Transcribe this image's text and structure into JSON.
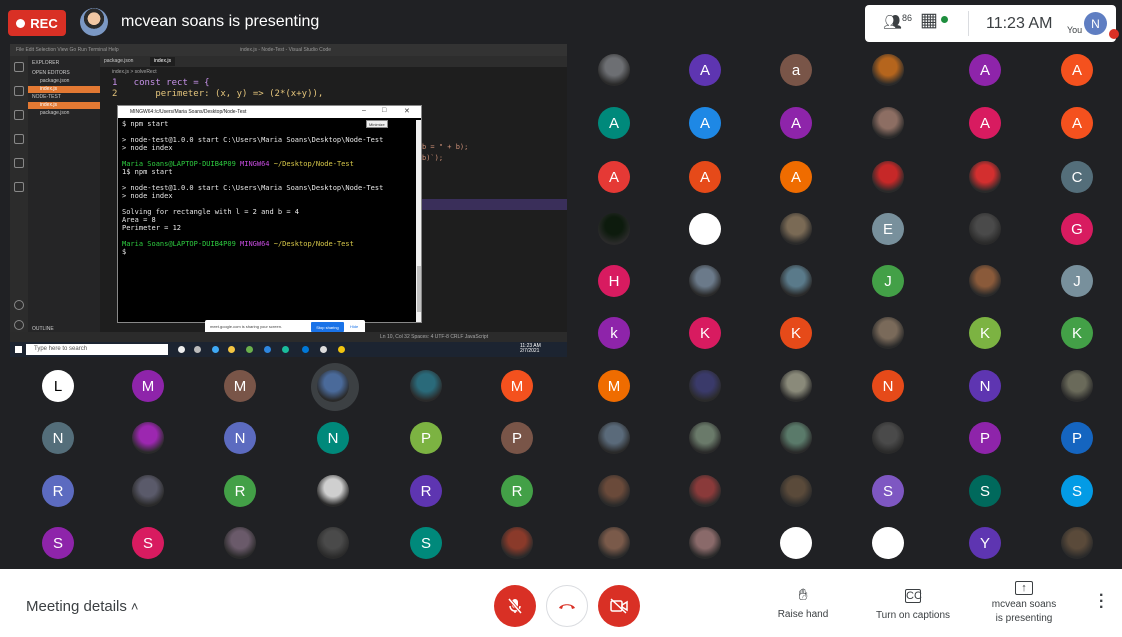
{
  "topbar": {
    "rec_label": "REC",
    "presenter_title": "mcvean soans is presenting",
    "participant_count": "86",
    "time": "11:23 AM",
    "you_label": "You",
    "self_initial": "N"
  },
  "screen": {
    "vscode_title": "index.js - Node-Test - Visual Studio Code",
    "menu": "File  Edit  Selection  View  Go  Run  Terminal  Help",
    "explorer": {
      "header": "EXPLORER",
      "open_editors": "OPEN EDITORS",
      "open_files": [
        "package.json",
        "index.js"
      ],
      "folder": "NODE-TEST",
      "folder_files": [
        "index.js",
        "package.json"
      ],
      "outline": "OUTLINE"
    },
    "tabs": [
      "package.json",
      "index.js"
    ],
    "breadcrumb": "index.js > solveRect",
    "code_lines": [
      "1   const rect = {",
      "2       perimeter: (x, y) => (2*(x+y)),"
    ],
    "code_fragments": [
      "b = \" + b);",
      "b)`);"
    ],
    "terminal": {
      "title": "MINGW64:/c/Users/Maria Soans/Desktop/Node-Test",
      "tooltip": "Minimize",
      "lines": [
        {
          "text": "$ npm start",
          "color": "white"
        },
        {
          "text": "",
          "color": "white"
        },
        {
          "text": "> node-test@1.0.0 start C:\\Users\\Maria Soans\\Desktop\\Node-Test",
          "color": "white"
        },
        {
          "text": "> node index",
          "color": "white"
        },
        {
          "text": "",
          "color": "white"
        },
        {
          "text": "Maria Soans@LAPTOP-DUIB4P09 MINGW64 ~/Desktop/Node-Test",
          "color": "prompt"
        },
        {
          "text": "1$ npm start",
          "color": "white"
        },
        {
          "text": "",
          "color": "white"
        },
        {
          "text": "> node-test@1.0.0 start C:\\Users\\Maria Soans\\Desktop\\Node-Test",
          "color": "white"
        },
        {
          "text": "> node index",
          "color": "white"
        },
        {
          "text": "",
          "color": "white"
        },
        {
          "text": "Solving for rectangle with l = 2 and b = 4",
          "color": "white"
        },
        {
          "text": "Area = 8",
          "color": "white"
        },
        {
          "text": "Perimeter = 12",
          "color": "white"
        },
        {
          "text": "",
          "color": "white"
        },
        {
          "text": "Maria Soans@LAPTOP-DUIB4P09 MINGW64 ~/Desktop/Node-Test",
          "color": "prompt"
        },
        {
          "text": "$",
          "color": "white"
        }
      ]
    },
    "share_bar": {
      "text": "meet.google.com is sharing your screen.",
      "stop_label": "Stop sharing",
      "hide_label": "Hide"
    },
    "status_bar": "Ln 10, Col 32   Spaces: 4   UTF-8   CRLF   JavaScript",
    "taskbar": {
      "search_placeholder": "Type here to search",
      "clock_time": "11:23 AM",
      "clock_date": "2/7/2021"
    }
  },
  "participants": [
    {
      "initial": "",
      "color": "#6d6f73",
      "photo": true
    },
    {
      "initial": "A",
      "color": "#5e35b1"
    },
    {
      "initial": "a",
      "color": "#795548"
    },
    {
      "initial": "",
      "color": "#b5651d",
      "photo": true
    },
    {
      "initial": "A",
      "color": "#8e24aa"
    },
    {
      "initial": "A",
      "color": "#f4511e"
    },
    {
      "initial": "A",
      "color": "#00897b"
    },
    {
      "initial": "A",
      "color": "#1e88e5"
    },
    {
      "initial": "A",
      "color": "#8e24aa"
    },
    {
      "initial": "",
      "color": "#8d6e63",
      "photo": true
    },
    {
      "initial": "A",
      "color": "#d81b60"
    },
    {
      "initial": "A",
      "color": "#f4511e"
    },
    {
      "initial": "A",
      "color": "#e53935"
    },
    {
      "initial": "A",
      "color": "#e64a19"
    },
    {
      "initial": "A",
      "color": "#ef6c00"
    },
    {
      "initial": "",
      "color": "#c62828",
      "photo": true
    },
    {
      "initial": "",
      "color": "#d32f2f",
      "photo": true
    },
    {
      "initial": "C",
      "color": "#546e7a"
    },
    {
      "initial": "",
      "color": "#0d1b0d",
      "photo": true
    },
    {
      "initial": "",
      "color": "#ffffff",
      "photo": true
    },
    {
      "initial": "",
      "color": "#7a6a55",
      "photo": true
    },
    {
      "initial": "E",
      "color": "#78909c"
    },
    {
      "initial": "",
      "color": "#4a4a4a",
      "photo": true
    },
    {
      "initial": "G",
      "color": "#d81b60"
    },
    {
      "initial": "H",
      "color": "#d81b60"
    },
    {
      "initial": "",
      "color": "#6b7a8a",
      "photo": true
    },
    {
      "initial": "",
      "color": "#5a7a8a",
      "photo": true
    },
    {
      "initial": "J",
      "color": "#43a047"
    },
    {
      "initial": "",
      "color": "#8a5a3a",
      "photo": true
    },
    {
      "initial": "J",
      "color": "#78909c"
    },
    {
      "initial": "k",
      "color": "#8e24aa"
    },
    {
      "initial": "K",
      "color": "#d81b60"
    },
    {
      "initial": "K",
      "color": "#e64a19"
    },
    {
      "initial": "",
      "color": "#7a6a5a",
      "photo": true
    },
    {
      "initial": "K",
      "color": "#7cb342"
    },
    {
      "initial": "K",
      "color": "#43a047"
    },
    {
      "initial": "L",
      "color": "#ffffff",
      "text_color": "#000000",
      "photo": true
    },
    {
      "initial": "M",
      "color": "#8e24aa"
    },
    {
      "initial": "M",
      "color": "#795548"
    },
    {
      "initial": "",
      "color": "#4a6a9a",
      "photo": true,
      "ring": true
    },
    {
      "initial": "",
      "color": "#2a6a7a",
      "photo": true
    },
    {
      "initial": "M",
      "color": "#f4511e"
    },
    {
      "initial": "M",
      "color": "#ef6c00"
    },
    {
      "initial": "",
      "color": "#3a3a6a",
      "photo": true
    },
    {
      "initial": "",
      "color": "#8a8a7a",
      "photo": true
    },
    {
      "initial": "N",
      "color": "#e64a19"
    },
    {
      "initial": "N",
      "color": "#5e35b1"
    },
    {
      "initial": "",
      "color": "#6a6a5a",
      "photo": true
    },
    {
      "initial": "N",
      "color": "#546e7a"
    },
    {
      "initial": "",
      "color": "#9c27b0",
      "photo": true
    },
    {
      "initial": "N",
      "color": "#5c6bc0"
    },
    {
      "initial": "N",
      "color": "#00897b"
    },
    {
      "initial": "P",
      "color": "#7cb342"
    },
    {
      "initial": "P",
      "color": "#795548"
    },
    {
      "initial": "",
      "color": "#5a6a7a",
      "photo": true
    },
    {
      "initial": "",
      "color": "#6a7a6a",
      "photo": true
    },
    {
      "initial": "",
      "color": "#5a7a6a",
      "photo": true
    },
    {
      "initial": "",
      "color": "#4a4a4a",
      "photo": true
    },
    {
      "initial": "P",
      "color": "#8e24aa"
    },
    {
      "initial": "P",
      "color": "#1565c0"
    },
    {
      "initial": "R",
      "color": "#5c6bc0"
    },
    {
      "initial": "",
      "color": "#5a5a6a",
      "photo": true
    },
    {
      "initial": "R",
      "color": "#43a047"
    },
    {
      "initial": "",
      "color": "#cfcfcf",
      "photo": true
    },
    {
      "initial": "R",
      "color": "#5e35b1"
    },
    {
      "initial": "R",
      "color": "#43a047"
    },
    {
      "initial": "",
      "color": "#6a4a3a",
      "photo": true
    },
    {
      "initial": "",
      "color": "#8a3a3a",
      "photo": true
    },
    {
      "initial": "",
      "color": "#5a4a3a",
      "photo": true
    },
    {
      "initial": "S",
      "color": "#7e57c2"
    },
    {
      "initial": "S",
      "color": "#00695c"
    },
    {
      "initial": "S",
      "color": "#039be5"
    },
    {
      "initial": "S",
      "color": "#8e24aa"
    },
    {
      "initial": "S",
      "color": "#d81b60"
    },
    {
      "initial": "",
      "color": "#6a5a6a",
      "photo": true
    },
    {
      "initial": "",
      "color": "#4a4a4a",
      "photo": true
    },
    {
      "initial": "S",
      "color": "#00897b"
    },
    {
      "initial": "",
      "color": "#8a3a2a",
      "photo": true
    },
    {
      "initial": "",
      "color": "#7a5a4a",
      "photo": true
    },
    {
      "initial": "",
      "color": "#8a6a6a",
      "photo": true
    },
    {
      "initial": "",
      "color": "#ffffff",
      "photo": true
    },
    {
      "initial": "",
      "color": "#ffffff",
      "photo": true
    },
    {
      "initial": "Y",
      "color": "#5e35b1"
    },
    {
      "initial": "",
      "color": "#5a4a3a",
      "photo": true
    }
  ],
  "bottombar": {
    "meeting_details": "Meeting details",
    "raise_hand": "Raise hand",
    "captions": "Turn on captions",
    "presenting_line1": "mcvean soans",
    "presenting_line2": "is presenting",
    "colors": {
      "red": "#d93025"
    }
  }
}
